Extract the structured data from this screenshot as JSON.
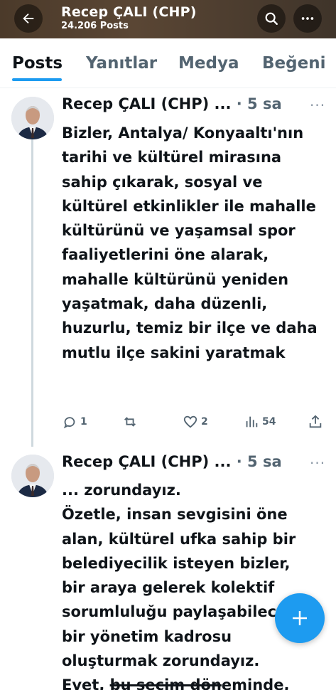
{
  "header": {
    "title": "Recep ÇALI (CHP)",
    "post_count": "24.206 Posts",
    "icons": [
      "back-arrow-icon",
      "search-icon",
      "more-icon"
    ]
  },
  "tabs": [
    "Posts",
    "Yanıtlar",
    "Medya",
    "Beğeni"
  ],
  "colors": {
    "accent": "#1d9bf0",
    "text": "#0f1419",
    "muted": "#536471"
  },
  "tweets": [
    {
      "author": "Recep ÇALI (CHP) ...",
      "time": "· 5 sa",
      "more": "···",
      "text": "Bizler, Antalya/ Konyaaltı'nın tarihi ve kültürel mirasına sahip çıkarak, sosyal ve kültürel etkinlikler ile mahalle kültürünü ve yaşamsal spor faaliyetlerini öne alarak, mahalle kültürünü yeniden yaşatmak, daha düzenli, huzurlu, temiz bir ilçe ve daha mutlu ilçe sakini yaratmak",
      "replies": "1",
      "retweets": "",
      "likes": "2",
      "views": "54"
    },
    {
      "author": "Recep ÇALI (CHP) ...",
      "time": "· 5 sa",
      "more": "···",
      "text_lead": "... zorundayız.",
      "text_main": "Özetle, insan sevgisini öne alan, kültürel ufka sahip bir belediyecilik isteyen bizler, bir araya gelerek kolektif sorumluluğu paylaşabilecek bir yönetim kadrosu oluşturmak zorundayız.",
      "text_tail_start": "Evet, ",
      "text_tail_struck": "bu seçim dön",
      "text_tail_end": "eminde,"
    }
  ]
}
